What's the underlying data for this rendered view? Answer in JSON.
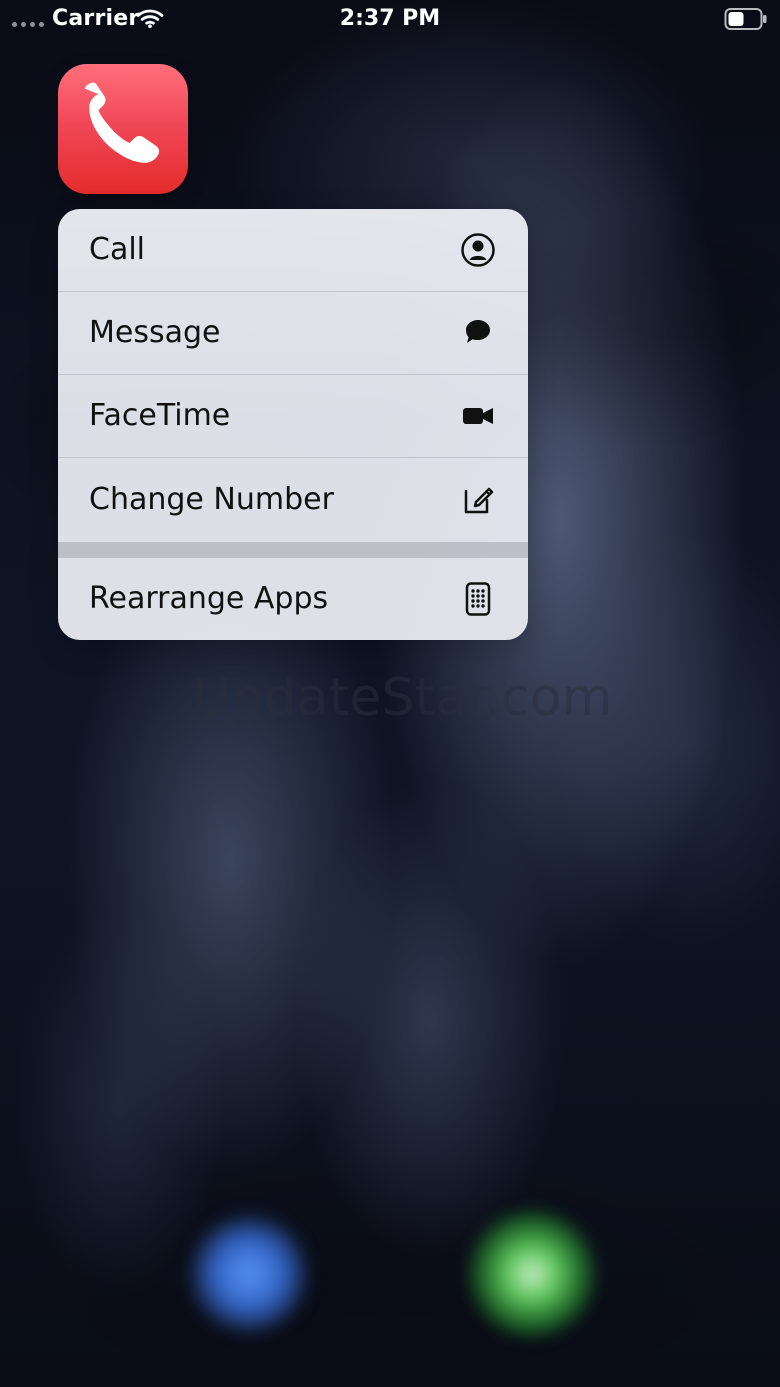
{
  "status_bar": {
    "carrier": "Carrier",
    "time": "2:37 PM",
    "wifi_icon": "wifi-icon",
    "battery_icon": "battery-icon"
  },
  "home_screen": {
    "app_icon": {
      "icon": "phone-icon",
      "color_top": "#ff6f7c",
      "color_bottom": "#e42c2c"
    },
    "quick_actions": [
      {
        "label": "Call",
        "icon": "contact-icon"
      },
      {
        "label": "Message",
        "icon": "message-icon"
      },
      {
        "label": "FaceTime",
        "icon": "video-camera-icon"
      },
      {
        "label": "Change Number",
        "icon": "edit-icon"
      },
      {
        "label": "Rearrange Apps",
        "icon": "phone-grid-icon"
      }
    ],
    "watermark": "UpdateStar.com"
  },
  "dock": {
    "left_blur_color": "#4f8ef7",
    "right_blur_color": "#55df59"
  }
}
